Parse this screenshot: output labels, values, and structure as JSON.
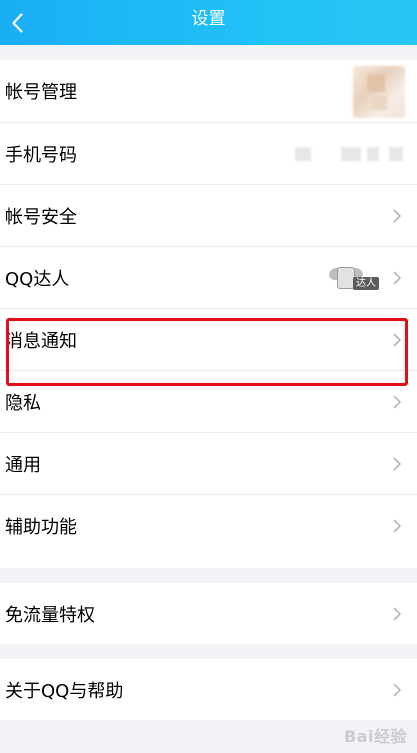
{
  "header": {
    "title": "设置",
    "back_icon": "chevron-left-icon"
  },
  "colors": {
    "header_gradient_start": "#1aaef5",
    "header_gradient_end": "#27c7f4",
    "background": "#f2f3f7",
    "row_background": "#ffffff",
    "highlight_border": "#e60c18"
  },
  "settings": {
    "group1": [
      {
        "id": "account-management",
        "label": "帐号管理",
        "trailing": "avatar"
      },
      {
        "id": "phone-number",
        "label": "手机号码",
        "trailing": "blurred-value"
      },
      {
        "id": "account-security",
        "label": "帐号安全",
        "trailing": "chevron"
      },
      {
        "id": "qq-expert",
        "label": "QQ达人",
        "trailing": "badge+chevron",
        "badge_text": "达人"
      },
      {
        "id": "message-notification",
        "label": "消息通知",
        "trailing": "chevron",
        "highlighted": true
      },
      {
        "id": "privacy",
        "label": "隐私",
        "trailing": "chevron"
      },
      {
        "id": "general",
        "label": "通用",
        "trailing": "chevron"
      },
      {
        "id": "accessibility",
        "label": "辅助功能",
        "trailing": "chevron"
      }
    ],
    "group2": [
      {
        "id": "data-free",
        "label": "免流量特权",
        "trailing": "chevron"
      }
    ],
    "group3": [
      {
        "id": "about-help",
        "label": "关于QQ与帮助",
        "trailing": "chevron"
      }
    ]
  },
  "watermark": "Bai经验"
}
